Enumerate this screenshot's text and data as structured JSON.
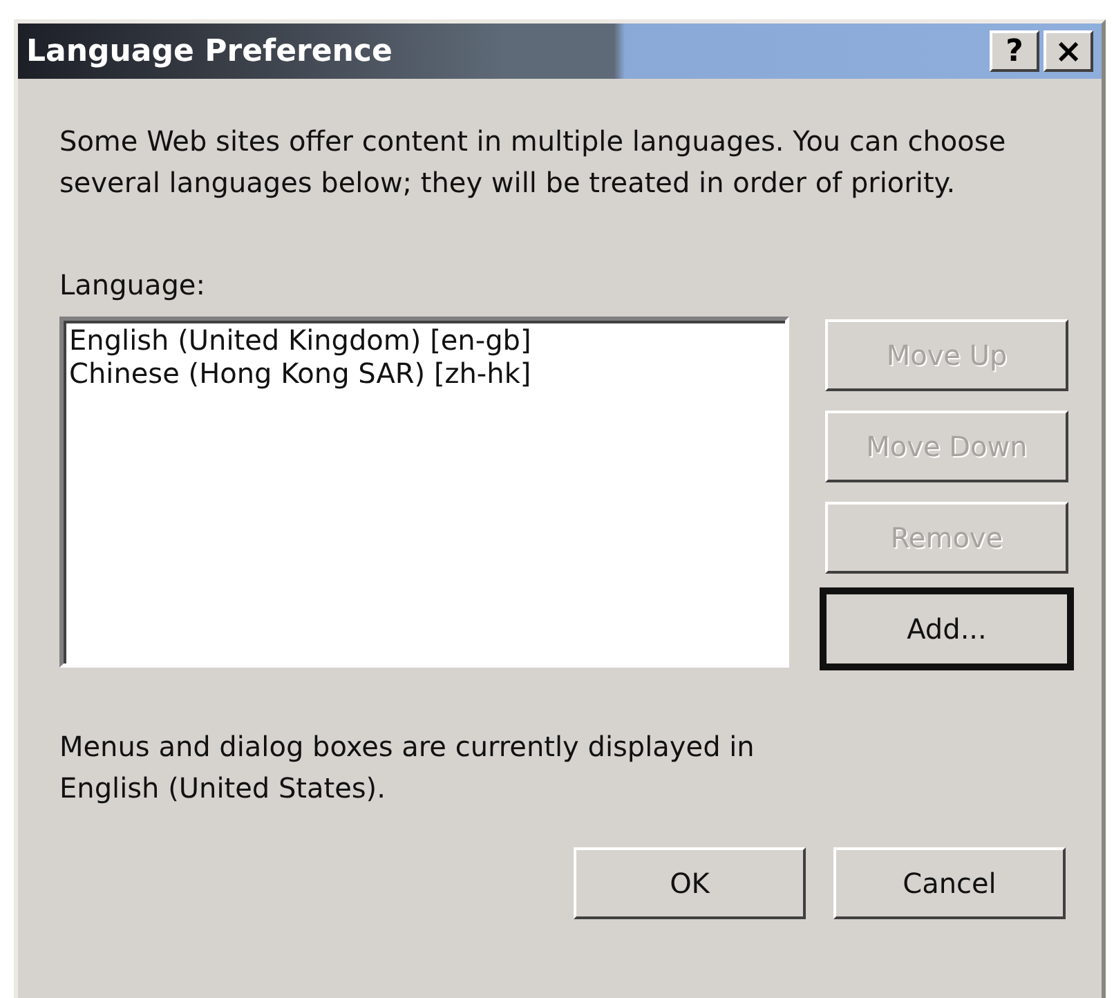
{
  "window": {
    "title": "Language Preference",
    "title_buttons": [
      {
        "kind": "help",
        "label": "?"
      },
      {
        "kind": "close",
        "label": "×"
      }
    ]
  },
  "intro": "Some Web sites offer content in multiple languages. You can choose several languages below; they will be treated in order of priority.",
  "list_label": "Language:",
  "languages": [
    {
      "label": "English (United Kingdom) [en-gb]",
      "selected": false
    },
    {
      "label": "Chinese (Hong Kong SAR) [zh-hk]",
      "selected": false
    }
  ],
  "side_buttons": [
    {
      "label": "Move Up",
      "disabled": true,
      "focused": false
    },
    {
      "label": "Move Down",
      "disabled": true,
      "focused": false
    },
    {
      "label": "Remove",
      "disabled": true,
      "focused": false
    },
    {
      "label": "Add...",
      "disabled": false,
      "focused": true
    }
  ],
  "note": "Menus and dialog boxes are currently displayed in English (United States).",
  "footer_buttons": [
    {
      "label": "OK",
      "disabled": false,
      "focused": false
    },
    {
      "label": "Cancel",
      "disabled": false,
      "focused": false
    }
  ]
}
